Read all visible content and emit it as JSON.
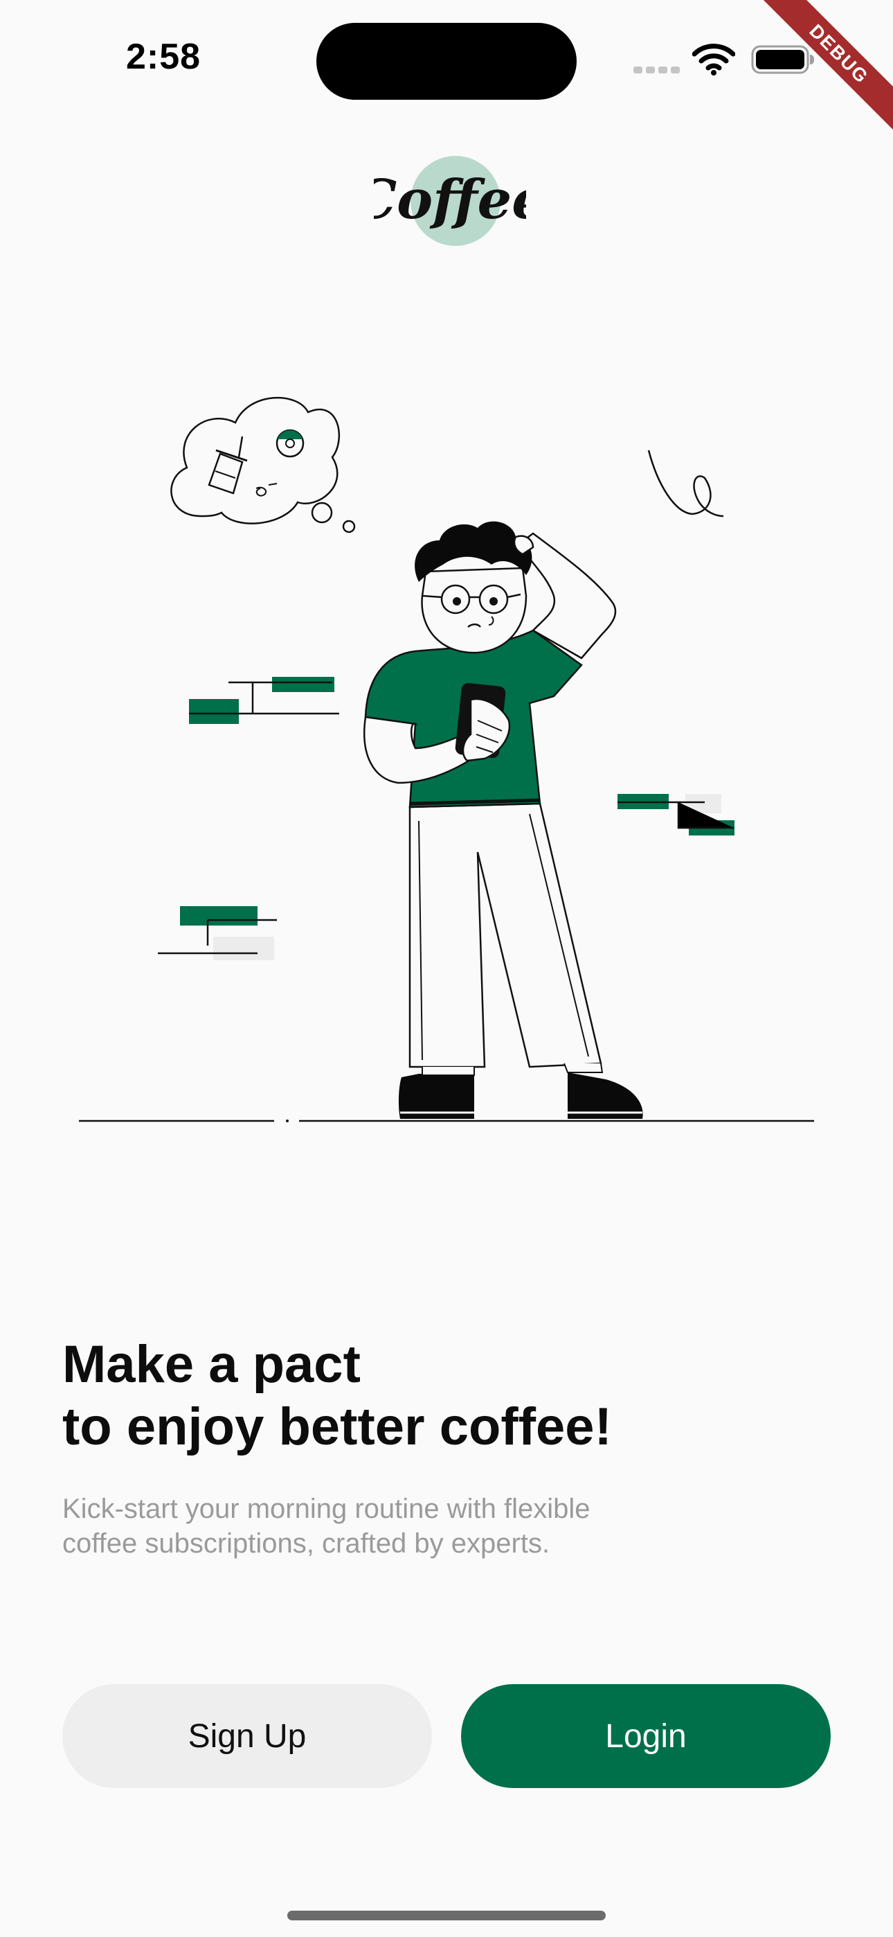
{
  "status_bar": {
    "time": "2:58"
  },
  "debug_banner": {
    "label": "DEBUG"
  },
  "logo": {
    "text": "Coffee"
  },
  "onboarding": {
    "headline_line1": "Make a pact",
    "headline_line2": "to enjoy better coffee!",
    "subtitle_line1": "Kick-start your morning routine with flexible",
    "subtitle_line2": "coffee subscriptions, crafted by experts."
  },
  "actions": {
    "signup_label": "Sign Up",
    "login_label": "Login"
  },
  "colors": {
    "accent": "#00704a",
    "accent_light": "#b9d9cc",
    "background": "#fafafa",
    "secondary_button": "#eeeeee",
    "subtitle_text": "#9a9a9a",
    "debug_banner": "#a52c2c"
  },
  "icons": {
    "wifi": "wifi-icon",
    "battery": "battery-icon",
    "signal": "signal-dots-icon"
  }
}
